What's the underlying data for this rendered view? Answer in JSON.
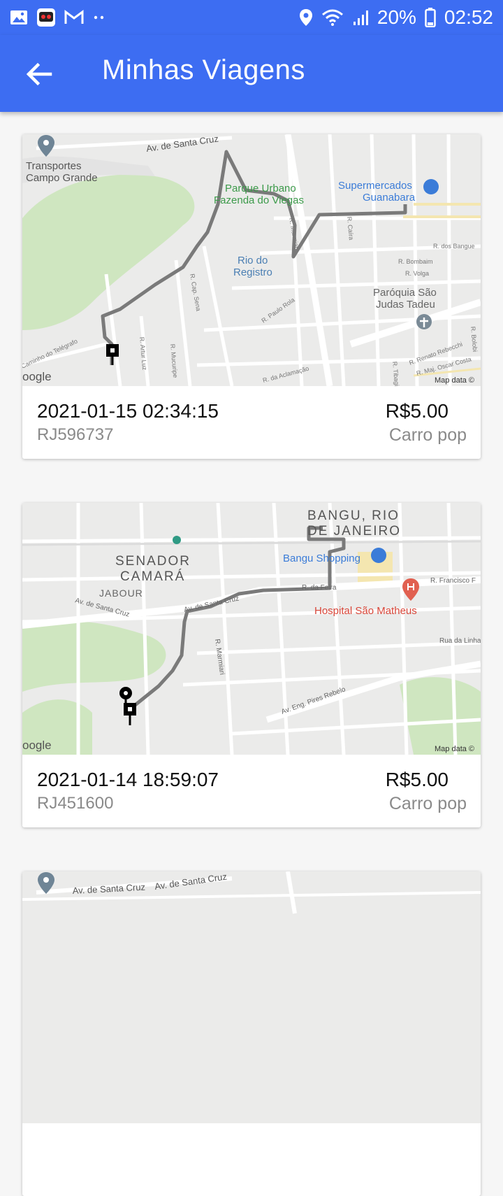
{
  "status_bar": {
    "battery": "20%",
    "time": "02:52",
    "icons": [
      "gallery-icon",
      "app-icon",
      "gmail-icon",
      "more-icon",
      "location-icon",
      "wifi-icon",
      "signal-icon",
      "battery-icon"
    ]
  },
  "header": {
    "title": "Minhas Viagens",
    "back_icon": "arrow-left-icon",
    "color": "#3d6df2"
  },
  "trips": [
    {
      "datetime": "2021-01-15 02:34:15",
      "code": "RJ596737",
      "price": "R$5.00",
      "category": "Carro pop",
      "map_labels": {
        "poi1": "Transportes",
        "poi1b": "Campo Grande",
        "street1": "Av. de Santa Cruz",
        "park1": "Parque Urbano",
        "park1b": "Fazenda do Viegas",
        "market1": "Supermercados",
        "market1b": "Guanabara",
        "area1": "Rio do",
        "area1b": "Registro",
        "church1": "Paróquia São",
        "church1b": "Judas Tadeu",
        "street_marmiari": "R. Marmiari",
        "street_bombaim": "R. Bombaim",
        "street_volga": "R. Volga",
        "street_banguc": "R. dos Bangue",
        "street_caira": "R. Caíra",
        "street_paulo": "R. Paulo Rola",
        "street_aclamacao": "R. da Aclamação",
        "street_capsena": "R. Cap. Sena",
        "street_mucuripe": "R. Mucuripe",
        "street_arturluz": "R. Artur Luz",
        "street_telegrafo": "Caminho do Telégrafo",
        "street_rebecchi": "R. Renato Rebecchi",
        "street_oscar": "R. Maj. Oscar Costa",
        "street_tibagi": "R. Tibagi",
        "street_bolobi": "R. Bolobi",
        "google": "oogle",
        "mapdata": "Map data ©"
      }
    },
    {
      "datetime": "2021-01-14 18:59:07",
      "code": "RJ451600",
      "price": "R$5.00",
      "category": "Carro pop",
      "map_labels": {
        "district1": "BANGU, RIO",
        "district1b": "DE JANEIRO",
        "district2": "SENADOR",
        "district2b": "CAMARÁ",
        "area_jabour": "JABOUR",
        "mall": "Bangu Shopping",
        "hospital": "Hospital São Matheus",
        "street_feira": "R. da Feira",
        "street_santacruz1": "Av. de Santa Cruz",
        "street_santacruz2": "Av. de Santa Cruz",
        "street_marmiari": "R. Marmiari",
        "street_pires": "Av. Eng. Pires Rebelo",
        "street_francisco": "R. Francisco F",
        "street_linha": "Rua da Linha",
        "google": "oogle",
        "mapdata": "Map data ©"
      }
    },
    {
      "map_labels": {
        "street1": "Av. de Santa Cruz",
        "street2": "Av. de Santa Cruz"
      }
    }
  ]
}
